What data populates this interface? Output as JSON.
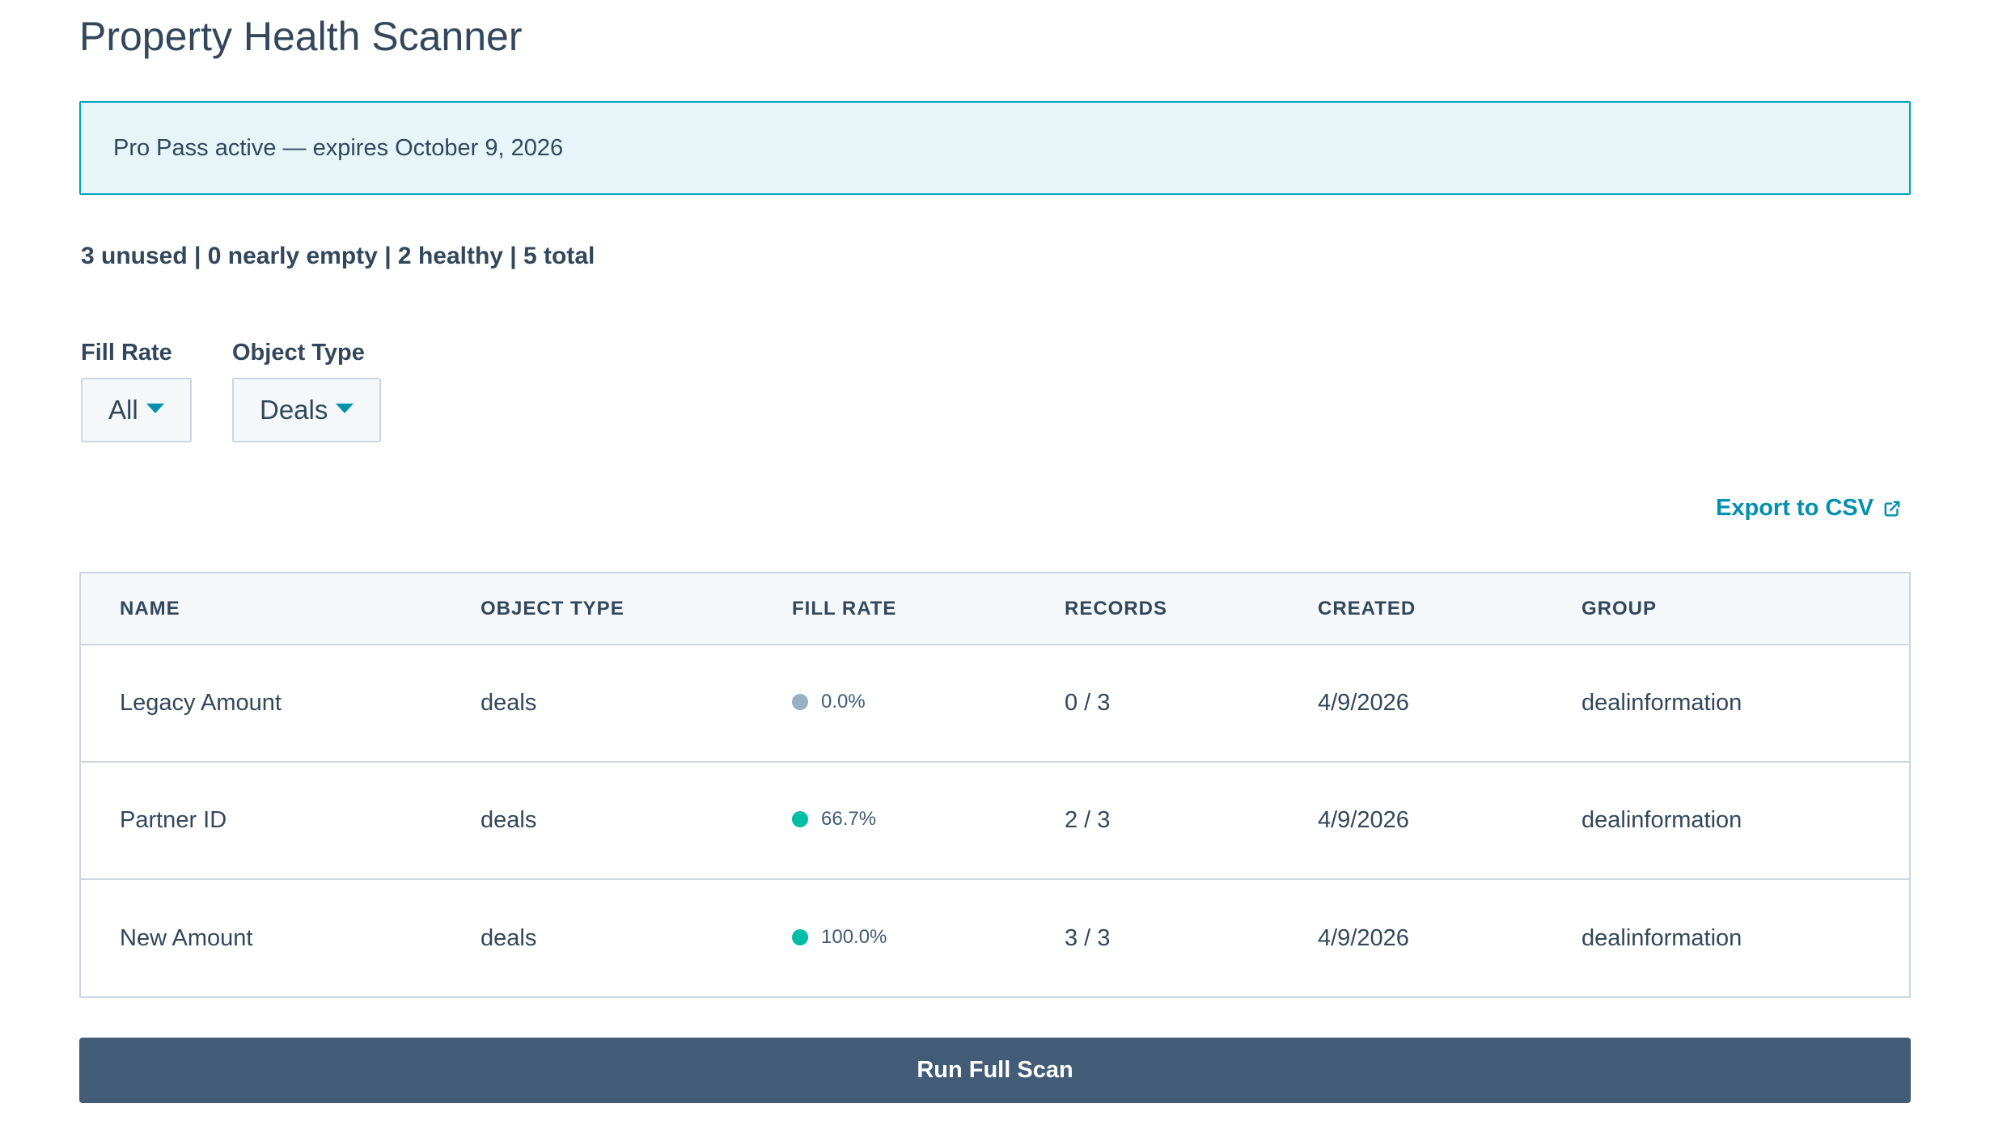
{
  "page": {
    "title": "Property Health Scanner"
  },
  "alert": {
    "text": "Pro Pass active — expires October 9, 2026"
  },
  "summary": {
    "text": "3 unused | 0 nearly empty | 2 healthy | 5 total"
  },
  "filters": {
    "fill_rate": {
      "label": "Fill Rate",
      "selected": "All"
    },
    "object_type": {
      "label": "Object Type",
      "selected": "Deals"
    }
  },
  "export": {
    "label": "Export to CSV",
    "icon": "external-link-icon"
  },
  "table": {
    "columns": [
      "NAME",
      "OBJECT TYPE",
      "FILL RATE",
      "RECORDS",
      "CREATED",
      "GROUP"
    ],
    "rows": [
      {
        "name": "Legacy Amount",
        "object_type": "deals",
        "fill_rate": "0.0%",
        "fill_status_color": "#99afc4",
        "records": "0 / 3",
        "created": "4/9/2026",
        "group": "dealinformation"
      },
      {
        "name": "Partner ID",
        "object_type": "deals",
        "fill_rate": "66.7%",
        "fill_status_color": "#00bda5",
        "records": "2 / 3",
        "created": "4/9/2026",
        "group": "dealinformation"
      },
      {
        "name": "New Amount",
        "object_type": "deals",
        "fill_rate": "100.0%",
        "fill_status_color": "#00bda5",
        "records": "3 / 3",
        "created": "4/9/2026",
        "group": "dealinformation"
      }
    ]
  },
  "actions": {
    "run_scan_label": "Run Full Scan"
  },
  "colors": {
    "accent": "#0091ae",
    "alert_background": "#e5f5f8",
    "alert_border": "#00a4bd",
    "primary_button": "#425b76",
    "text": "#33475b"
  }
}
